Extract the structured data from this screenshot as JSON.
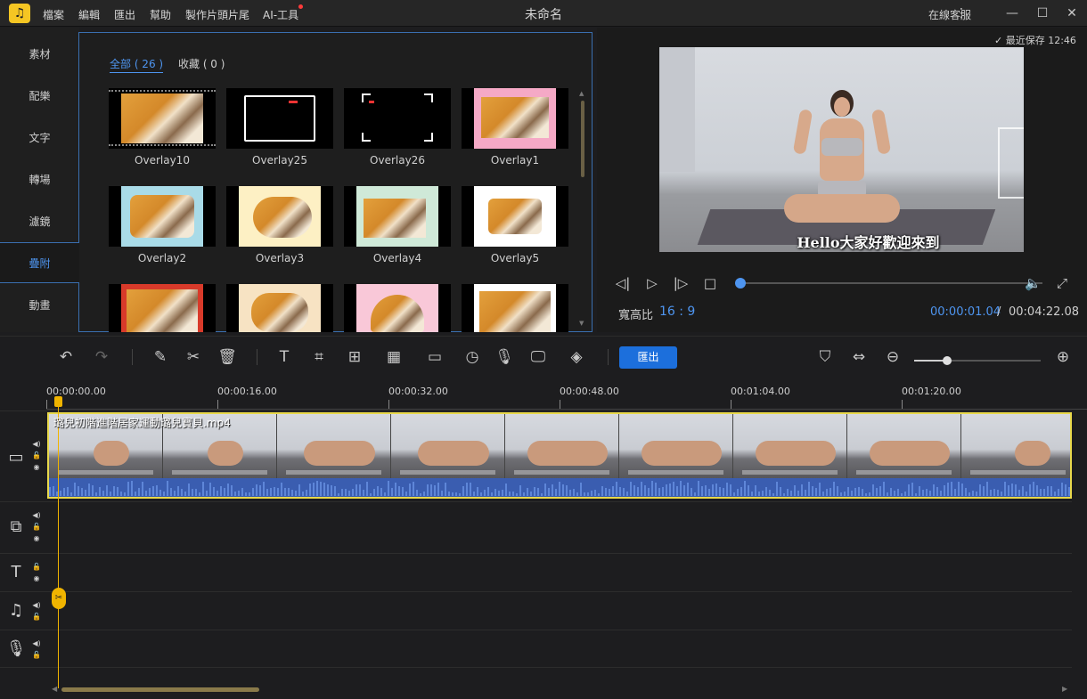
{
  "titlebar": {
    "logo": "logo-icon",
    "menu": [
      "檔案",
      "編輯",
      "匯出",
      "幫助",
      "製作片頭片尾",
      "AI-工具"
    ],
    "title": "未命名",
    "support": "在線客服"
  },
  "left_nav": {
    "items": [
      "素材",
      "配樂",
      "文字",
      "轉場",
      "濾鏡",
      "疊附",
      "動畫"
    ],
    "active_index": 5
  },
  "library": {
    "tab_all": "全部 ( 26 )",
    "tab_fav": "收藏 ( 0 )",
    "items": [
      "Overlay10",
      "Overlay25",
      "Overlay26",
      "Overlay1",
      "Overlay2",
      "Overlay3",
      "Overlay4",
      "Overlay5"
    ]
  },
  "preview": {
    "saved": "最近保存 12:46",
    "subtitle": "Hello大家好歡迎來到",
    "aspect_label": "寬高比",
    "aspect_value": "16 : 9",
    "time_current": "00:00:01.04",
    "time_sep": "/",
    "time_total": "00:04:22.08",
    "progress": 0.004
  },
  "toolbar": {
    "export_label": "匯出",
    "zoom_level": 0.26
  },
  "timeline": {
    "ruler": [
      "00:00:00.00",
      "00:00:16.00",
      "00:00:32.00",
      "00:00:48.00",
      "00:01:04.00",
      "00:01:20.00"
    ],
    "clip_name": "璐兒初階進階居家運動璐兒寶貝.mp4"
  },
  "colors": {
    "accent": "#4e95f0",
    "export_button": "#1c6fdc",
    "playhead": "#f0b400",
    "clip_border": "#e9d94b",
    "waveform": "#3a5db0"
  }
}
